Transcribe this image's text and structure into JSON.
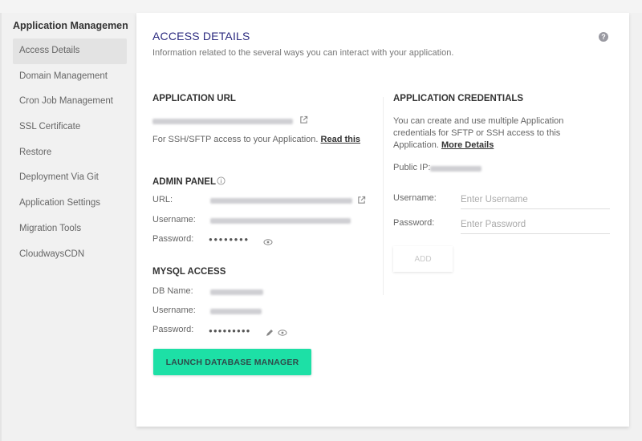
{
  "sidebar": {
    "title": "Application Management",
    "items": [
      {
        "label": "Access Details",
        "active": true
      },
      {
        "label": "Domain Management"
      },
      {
        "label": "Cron Job Management"
      },
      {
        "label": "SSL Certificate"
      },
      {
        "label": "Restore"
      },
      {
        "label": "Deployment Via Git"
      },
      {
        "label": "Application Settings"
      },
      {
        "label": "Migration Tools"
      },
      {
        "label": "CloudwaysCDN"
      }
    ]
  },
  "header": {
    "title": "ACCESS DETAILS",
    "subtitle": "Information related to the several ways you can interact with your application.",
    "help_icon": "?"
  },
  "app_url": {
    "title": "APPLICATION URL",
    "value_redacted": true,
    "ssh_text": "For SSH/SFTP access to your Application.",
    "read_link": "Read this"
  },
  "admin_panel": {
    "title": "ADMIN PANEL",
    "url_label": "URL:",
    "username_label": "Username:",
    "password_label": "Password:",
    "password_mask": "●●●●●●●●"
  },
  "mysql": {
    "title": "MYSQL ACCESS",
    "db_label": "DB Name:",
    "username_label": "Username:",
    "password_label": "Password:",
    "password_mask": "●●●●●●●●●",
    "launch_button": "LAUNCH DATABASE MANAGER"
  },
  "credentials": {
    "title": "APPLICATION CREDENTIALS",
    "desc_line1": "You can create and use multiple Application",
    "desc_line2": "credentials for SFTP or SSH access to this",
    "desc_line3": "Application.",
    "more_link": "More Details",
    "public_ip_label": "Public IP:",
    "username_label": "Username:",
    "username_placeholder": "Enter Username",
    "password_label": "Password:",
    "password_placeholder": "Enter Password",
    "add_button": "ADD"
  }
}
